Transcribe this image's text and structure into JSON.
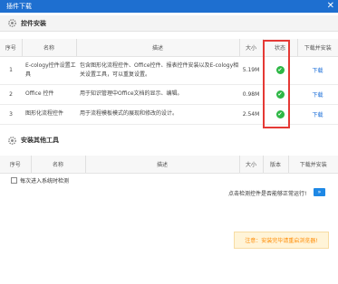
{
  "window": {
    "title": "插件下载",
    "close_label": "✕"
  },
  "section_plugins": {
    "title": "控件安装"
  },
  "plugins_table": {
    "headers": [
      "序号",
      "名称",
      "描述",
      "大小",
      "状态",
      "下载并安装"
    ],
    "rows": [
      {
        "index": "1",
        "name": "E-cology控件设置工具",
        "description": "包含图形化流程控件、Office控件、报表控件安装以及E-cology相关设置工具，可以重复设置。",
        "size": "5.19M",
        "status": "installed",
        "action": "下载"
      },
      {
        "index": "2",
        "name": "Office 控件",
        "description": "用于知识管理中Office文档的显示、编辑。",
        "size": "0.98M",
        "status": "installed",
        "action": "下载"
      },
      {
        "index": "3",
        "name": "图形化流程控件",
        "description": "用于流程模板模式的展现和修改的设计。",
        "size": "2.54M",
        "status": "installed",
        "action": "下载"
      }
    ]
  },
  "section_tools": {
    "title": "安装其他工具"
  },
  "tools_table": {
    "headers": [
      "序号",
      "名称",
      "描述",
      "大小",
      "版本",
      "下载并安装"
    ]
  },
  "startup_check": {
    "label": "每次进入系统时检测"
  },
  "detect": {
    "text": "点击检测控件是否能够正常运行!",
    "button": "»"
  },
  "notice": {
    "text": "注意：安装完毕请重启浏览器!"
  },
  "colors": {
    "titlebar": "#1e6fd0",
    "status_ok": "#2db745",
    "link": "#1a6ed8",
    "highlight_box": "#e53935",
    "notice_text": "#ff8a00"
  }
}
